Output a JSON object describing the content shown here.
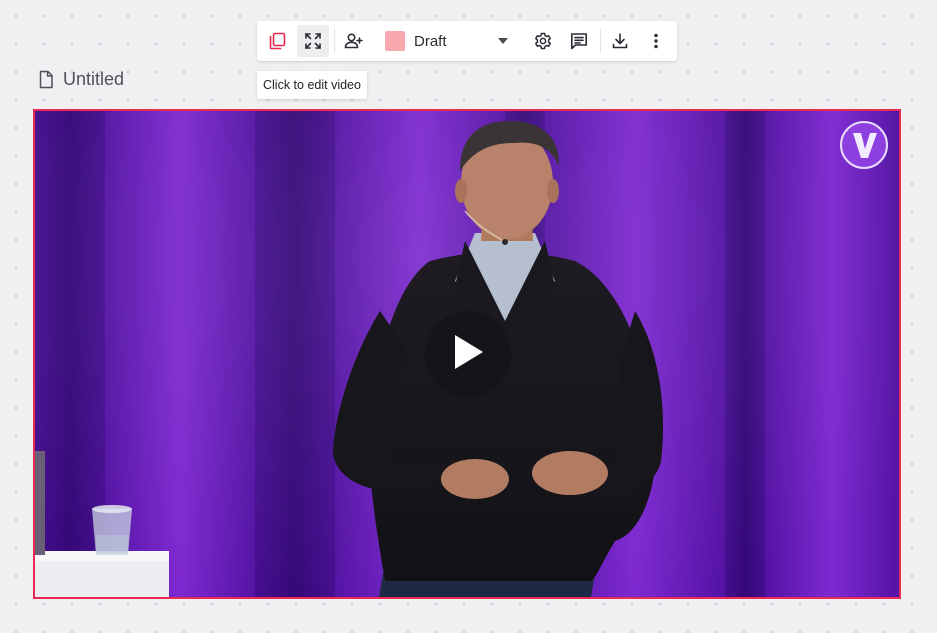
{
  "document": {
    "title": "Untitled",
    "icon": "document-icon"
  },
  "toolbar": {
    "buttons": [
      {
        "name": "copy-icon",
        "color": "#e8294f"
      },
      {
        "name": "fullscreen-icon",
        "active": true
      },
      {
        "name": "add-person-icon"
      },
      {
        "name": "settings-icon"
      },
      {
        "name": "comment-icon"
      },
      {
        "name": "download-icon"
      },
      {
        "name": "more-vertical-icon"
      }
    ],
    "status": {
      "label": "Draft",
      "swatch_color": "#f8a9b0",
      "icon": "chevron-down-icon"
    }
  },
  "tooltip": {
    "text": "Click to edit video"
  },
  "video": {
    "border_color": "#e82a55",
    "play_icon": "play-icon",
    "logo_icon": "v-logo-icon"
  }
}
